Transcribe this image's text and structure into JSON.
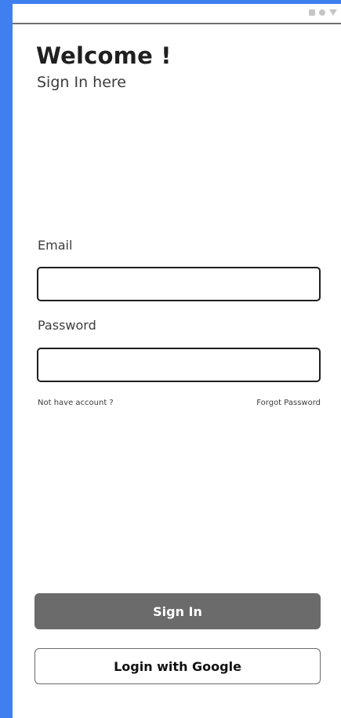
{
  "header": {
    "title": "Welcome !",
    "subtitle": "Sign In here"
  },
  "form": {
    "email_label": "Email",
    "email_value": "",
    "email_placeholder": "",
    "password_label": "Password",
    "password_value": "",
    "password_placeholder": "",
    "signup_link": "Not have account ?",
    "forgot_link": "Forgot Password"
  },
  "actions": {
    "signin_label": "Sign In",
    "google_label": "Login with Google"
  },
  "status_bar": {
    "icons": [
      "square-icon",
      "circle-icon",
      "triangle-icon"
    ]
  },
  "colors": {
    "background": "#3f7ff0",
    "signin_button": "#6b6b6b",
    "text_primary": "#1f1f1f"
  }
}
